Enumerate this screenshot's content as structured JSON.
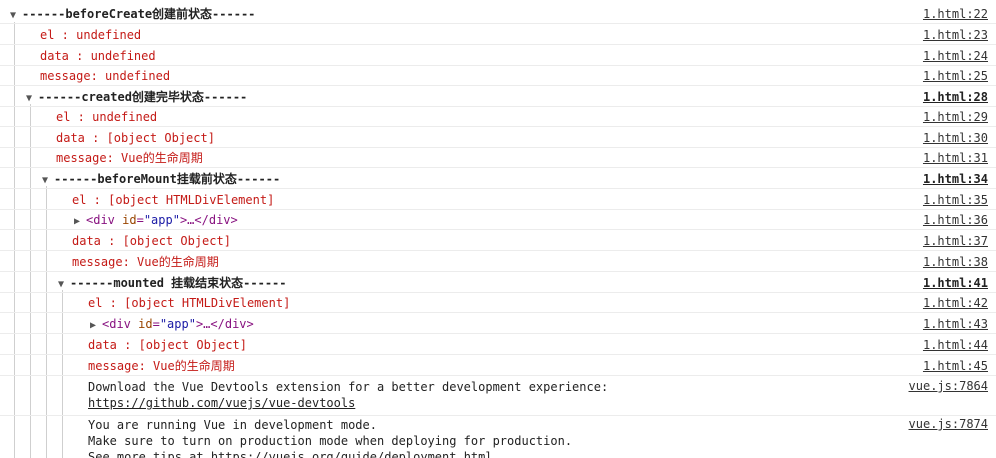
{
  "groups": [
    {
      "title": "------beforeCreate创建前状态------",
      "src": "1.html:22"
    },
    {
      "title": "------created创建完毕状态------",
      "src": "1.html:28"
    },
    {
      "title": "------beforeMount挂载前状态------",
      "src": "1.html:34"
    },
    {
      "title": "------mounted 挂载结束状态------",
      "src": "1.html:41"
    }
  ],
  "logs": {
    "g1": [
      {
        "text": "el     : undefined",
        "src": "1.html:23"
      },
      {
        "text": "data   : undefined",
        "src": "1.html:24"
      },
      {
        "text": "message: undefined",
        "src": "1.html:25"
      }
    ],
    "g2": [
      {
        "text": "el     : undefined",
        "src": "1.html:29"
      },
      {
        "text": "data   : [object Object]",
        "src": "1.html:30"
      },
      {
        "text": "message: Vue的生命周期",
        "src": "1.html:31"
      }
    ],
    "g3": [
      {
        "text": "el     : [object HTMLDivElement]",
        "src": "1.html:35"
      },
      {
        "src": "1.html:36"
      },
      {
        "text": "data   : [object Object]",
        "src": "1.html:37"
      },
      {
        "text": "message: Vue的生命周期",
        "src": "1.html:38"
      }
    ],
    "g4": [
      {
        "text": "el     : [object HTMLDivElement]",
        "src": "1.html:42"
      },
      {
        "src": "1.html:43"
      },
      {
        "text": "data   : [object Object]",
        "src": "1.html:44"
      },
      {
        "text": "message: Vue的生命周期",
        "src": "1.html:45"
      }
    ]
  },
  "div_node": {
    "open_tag": "<div",
    "attr_name": "id",
    "eq": "=",
    "attr_value": "\"app\"",
    "close": ">…</div>"
  },
  "devtools": {
    "line1": "Download the Vue Devtools extension for a better development experience:",
    "link": "https://github.com/vuejs/vue-devtools",
    "src": "vue.js:7864"
  },
  "devmode": {
    "line1": "You are running Vue in development mode.",
    "line2": "Make sure to turn on production mode when deploying for production.",
    "line3_prefix": "See more tips at ",
    "link": "https://vuejs.org/guide/deployment.html",
    "src": "vue.js:7874"
  },
  "icons": {
    "expanded": "expanded-triangle-icon",
    "collapsed": "collapsed-triangle-icon"
  }
}
